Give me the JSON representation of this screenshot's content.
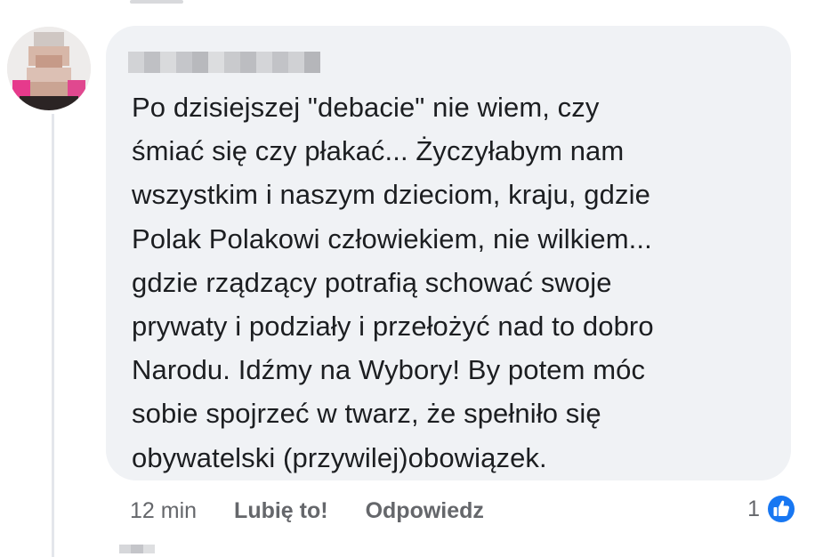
{
  "comment": {
    "author_name_pixelated": true,
    "text": "Po dzisiejszej \"debacie\" nie wiem, czy\nśmiać się czy płakać... Życzyłabym nam\nwszystkim i naszym dzieciom, kraju, gdzie\nPolak Polakowi człowiekiem, nie wilkiem...\ngdzie rządzący potrafią schować swoje\nprywaty i podziały i przełożyć nad to dobro\nNarodu. Idźmy na Wybory! By potem móc\nsobie spojrzeć w twarz, że spełniło się\nobywatelski (przywilej)obowiązek.",
    "timestamp": "12 min",
    "like_label": "Lubię to!",
    "reply_label": "Odpowiedz",
    "reaction_count": "1",
    "reaction_icon": "thumbs-up-icon"
  },
  "colors": {
    "bubble_background": "#f0f2f5",
    "text": "#1c1e21",
    "secondary_text": "#65676b",
    "like_blue": "#1877f2"
  }
}
